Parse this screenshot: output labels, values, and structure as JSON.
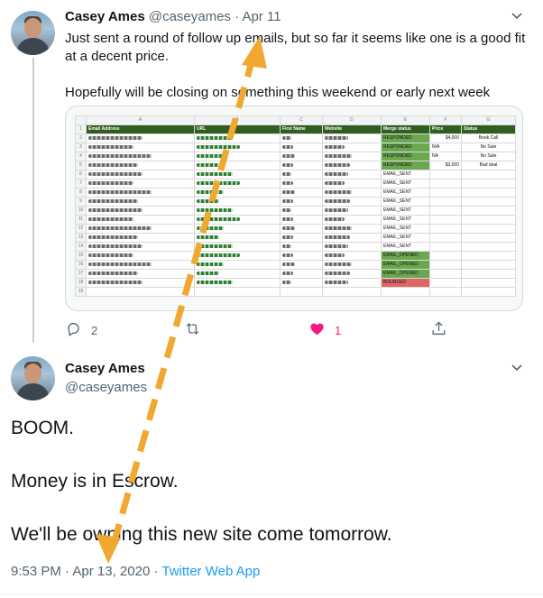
{
  "tweet1": {
    "name": "Casey Ames",
    "handle": "@caseyames",
    "separator": "·",
    "date": "Apr 11",
    "paragraphs": [
      "Just sent a round of follow up emails, but so far it seems like one is a good fit at a decent price.",
      "Hopefully will be closing on something this weekend or early next week"
    ],
    "replies": "2",
    "likes": "1"
  },
  "sheet": {
    "col_letters": [
      "",
      "A",
      "B",
      "C",
      "D",
      "E",
      "F",
      "G"
    ],
    "headers": [
      "Email Address",
      "URL",
      "First Name",
      "Website",
      "Merge status",
      "Price",
      "Status"
    ],
    "rows": [
      {
        "n": "2",
        "status": "RESPONDED",
        "price": "$4,000",
        "result": "Book Call"
      },
      {
        "n": "3",
        "status": "RESPONDED",
        "price": "N/A",
        "result": "No Sale"
      },
      {
        "n": "4",
        "status": "RESPONDED",
        "price": "NA",
        "result": "No Sale"
      },
      {
        "n": "5",
        "status": "RESPONDED",
        "price": "$3,000",
        "result": "Bad deal"
      },
      {
        "n": "6",
        "status": "EMAIL_SENT",
        "price": "",
        "result": ""
      },
      {
        "n": "7",
        "status": "EMAIL_SENT",
        "price": "",
        "result": ""
      },
      {
        "n": "8",
        "status": "EMAIL_SENT",
        "price": "",
        "result": ""
      },
      {
        "n": "9",
        "status": "EMAIL_SENT",
        "price": "",
        "result": ""
      },
      {
        "n": "10",
        "status": "EMAIL_SENT",
        "price": "",
        "result": ""
      },
      {
        "n": "11",
        "status": "EMAIL_SENT",
        "price": "",
        "result": ""
      },
      {
        "n": "12",
        "status": "EMAIL_SENT",
        "price": "",
        "result": ""
      },
      {
        "n": "13",
        "status": "EMAIL_SENT",
        "price": "",
        "result": ""
      },
      {
        "n": "14",
        "status": "EMAIL_SENT",
        "price": "",
        "result": ""
      },
      {
        "n": "15",
        "status": "EMAIL_OPENED",
        "price": "",
        "result": ""
      },
      {
        "n": "16",
        "status": "EMAIL_OPENED",
        "price": "",
        "result": ""
      },
      {
        "n": "17",
        "status": "EMAIL_OPENED",
        "price": "",
        "result": ""
      },
      {
        "n": "18",
        "status": "BOUNCED",
        "price": "",
        "result": ""
      },
      {
        "n": "19",
        "status": "",
        "price": "",
        "result": ""
      }
    ]
  },
  "tweet2": {
    "name": "Casey Ames",
    "handle": "@caseyames",
    "paragraphs": [
      "BOOM.",
      "Money is in Escrow.",
      "We'll be owning this new site come tomorrow."
    ],
    "time": "9:53 PM",
    "separator1": "·",
    "date": "Apr 13, 2020",
    "separator2": "·",
    "app": "Twitter Web App"
  },
  "colors": {
    "accent": "#1d9bf0",
    "like": "#f91880",
    "arrow": "#f0a830",
    "sheet_header": "#2f5e1e",
    "responded": "#6aa84f",
    "bounced": "#e06666"
  },
  "icons": [
    "reply-icon",
    "retweet-icon",
    "heart-icon",
    "share-icon",
    "chevron-down-icon"
  ]
}
